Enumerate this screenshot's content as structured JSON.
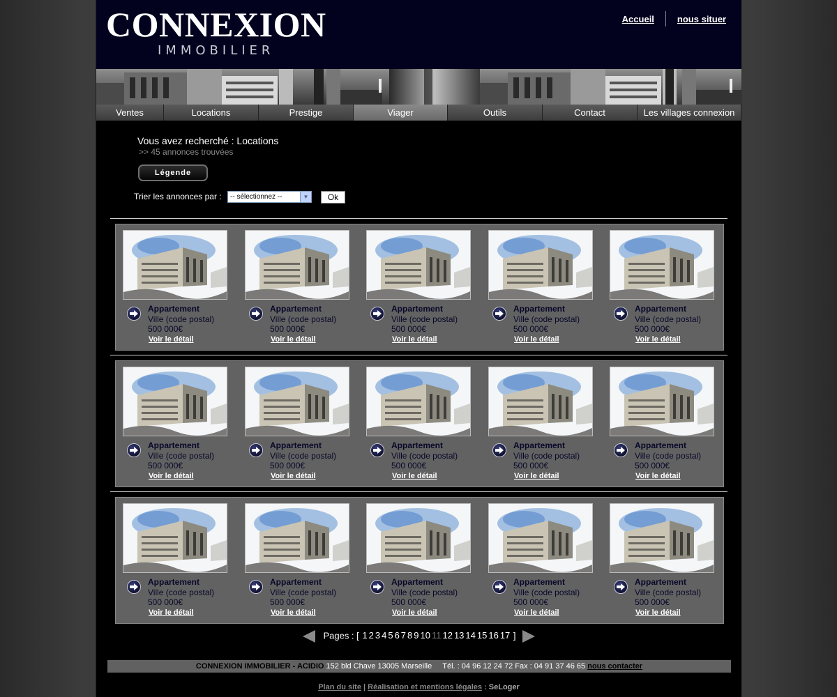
{
  "header": {
    "logo_main": "CONNEXION",
    "logo_sub": "IMMOBILIER",
    "links": [
      "Accueil",
      "nous situer"
    ]
  },
  "nav": {
    "items": [
      "Ventes",
      "Locations",
      "Prestige",
      "Viager",
      "Outils",
      "Contact",
      "Les villages connexion"
    ],
    "active": "Viager"
  },
  "search": {
    "title": "Vous avez recherché : Locations",
    "count": ">> 45 annonces trouvées",
    "legend_button": "Légende",
    "sort_label": "Trier les annonces par :",
    "sort_selected": "-- sélectionnez --",
    "ok_label": "Ok"
  },
  "listing": {
    "type": "Appartement",
    "city": "Ville (code postal)",
    "price": "500 000€",
    "detail_link": "Voir le détail"
  },
  "pagination": {
    "label": "Pages : [",
    "pages": [
      "1",
      "2",
      "3",
      "4",
      "5",
      "6",
      "7",
      "8",
      "9",
      "10",
      "11",
      "12",
      "13",
      "14",
      "15",
      "16",
      "17"
    ],
    "current": "11",
    "close": "]"
  },
  "footer": {
    "company": "CONNEXION IMMOBILIER - ACIDIO",
    "address": "152 bld Chave 13005 Marseille",
    "phones": "Tél. : 04 96 12 24 72 Fax : 04 91 37 46 65",
    "contact_link": "nous contacter",
    "links": [
      "Plan du site",
      "Réalisation et mentions légales"
    ],
    "sep": "|",
    "partner": "SeLoger"
  },
  "colors": {
    "header_bg": "#02021e",
    "page_bg": "#000000",
    "listing_bg": "#626262",
    "listing_text": "#08082a"
  }
}
